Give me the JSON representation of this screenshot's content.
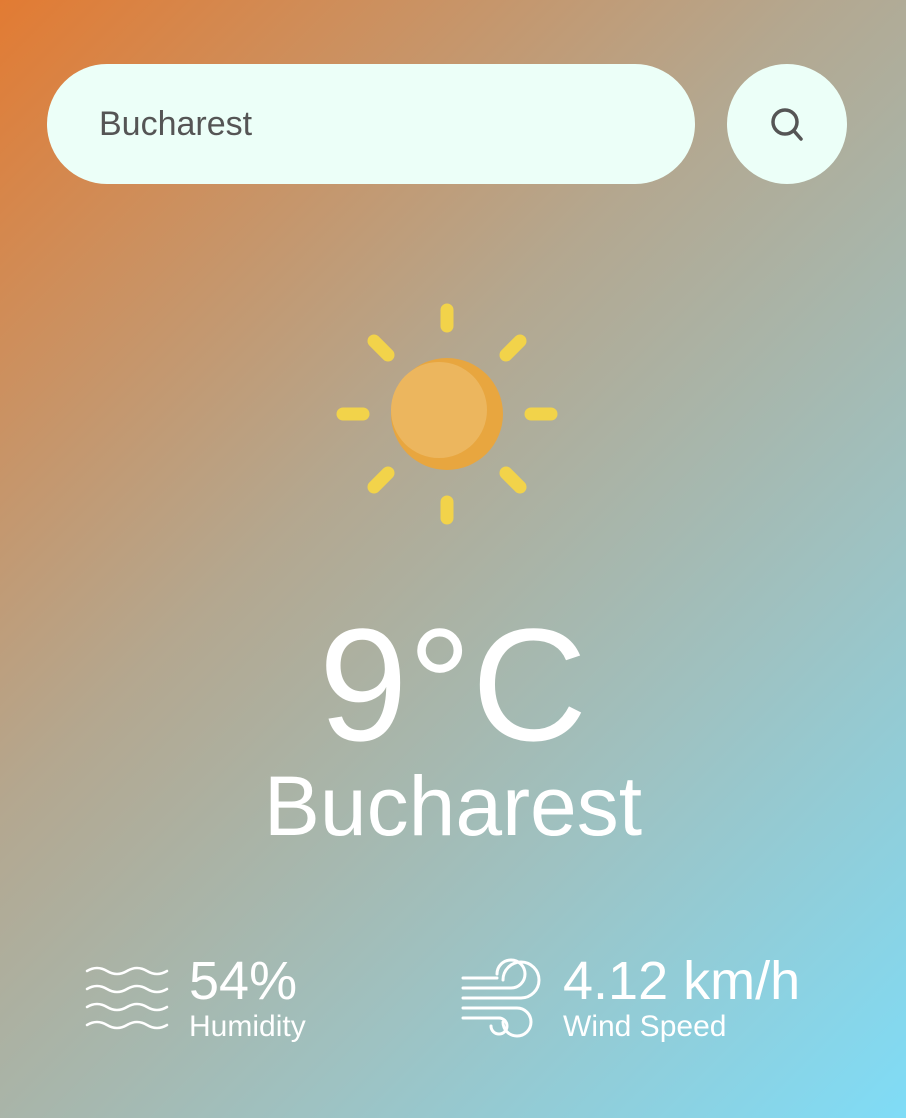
{
  "search": {
    "value": "Bucharest",
    "placeholder": ""
  },
  "icons": {
    "search": "search-icon",
    "weather": "sun-icon",
    "humidity": "waves-icon",
    "wind": "wind-icon"
  },
  "weather": {
    "temperature": "9°C",
    "city": "Bucharest"
  },
  "details": {
    "humidity": {
      "value": "54%",
      "label": "Humidity"
    },
    "wind": {
      "value": "4.12 km/h",
      "label": "Wind Speed"
    }
  },
  "colors": {
    "gradient_start": "#e27b33",
    "gradient_end": "#7fdcf7",
    "search_bg": "#ecfff8",
    "sun_body": "#ecb65e",
    "sun_rays": "#f2d34a"
  }
}
